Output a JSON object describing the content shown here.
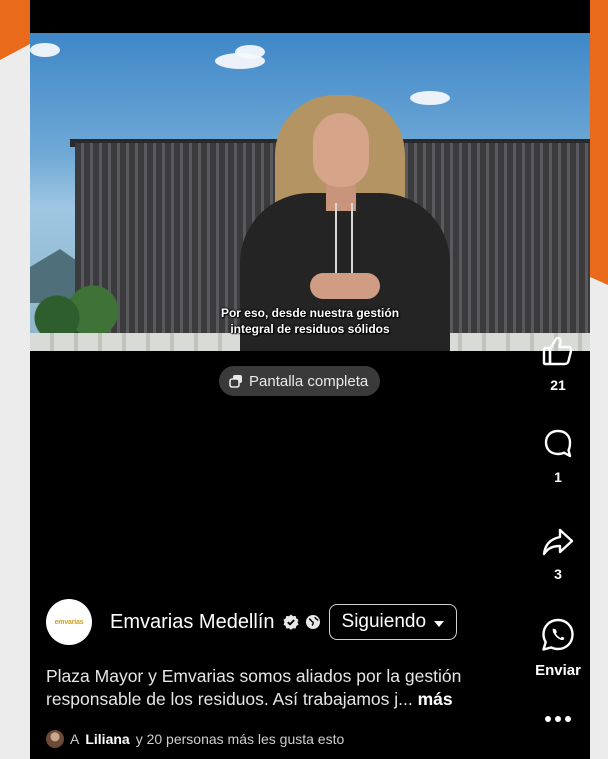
{
  "video": {
    "caption_line1": "Por eso, desde nuestra gestión",
    "caption_line2": "integral de residuos sólidos",
    "fullscreen_label": "Pantalla completa"
  },
  "actions": {
    "like_count": "21",
    "comment_count": "1",
    "share_count": "3",
    "send_label": "Enviar"
  },
  "post": {
    "avatar_text": "emvarias",
    "account_name": "Emvarias Medellín",
    "follow_label": "Siguiendo",
    "description": "Plaza Mayor y Emvarias somos aliados por la gestión responsable de los residuos. Así trabajamos j...",
    "more_label": "más",
    "likes_prefix": "A",
    "likes_name": "Liliana",
    "likes_suffix": "y 20 personas más les gusta esto"
  },
  "colors": {
    "accent_orange": "#ea6a1c",
    "background": "#000000"
  }
}
